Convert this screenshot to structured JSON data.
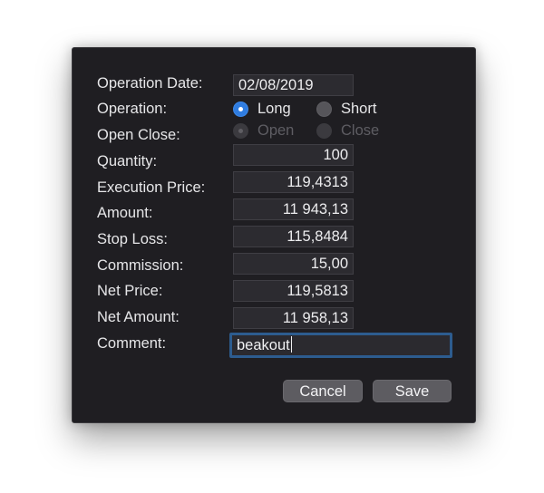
{
  "form": {
    "operation_date": {
      "label": "Operation Date:",
      "value": "02/08/2019"
    },
    "operation": {
      "label": "Operation:",
      "options": [
        {
          "label": "Long",
          "selected": true
        },
        {
          "label": "Short",
          "selected": false
        }
      ]
    },
    "open_close": {
      "label": "Open Close:",
      "disabled": true,
      "options": [
        {
          "label": "Open",
          "selected": true
        },
        {
          "label": "Close",
          "selected": false
        }
      ]
    },
    "quantity": {
      "label": "Quantity:",
      "value": "100"
    },
    "execution_price": {
      "label": "Execution Price:",
      "value": "119,4313"
    },
    "amount": {
      "label": "Amount:",
      "value": "11 943,13"
    },
    "stop_loss": {
      "label": "Stop Loss:",
      "value": "115,8484"
    },
    "commission": {
      "label": "Commission:",
      "value": "15,00"
    },
    "net_price": {
      "label": "Net Price:",
      "value": "119,5813"
    },
    "net_amount": {
      "label": "Net Amount:",
      "value": "11 958,13"
    },
    "comment": {
      "label": "Comment:",
      "value": "beakout"
    }
  },
  "buttons": {
    "cancel_label": "Cancel",
    "save_label": "Save"
  },
  "colors": {
    "dialog_background": "#1f1e22",
    "field_background": "#2c2b30",
    "focus_ring": "#2d5c8f",
    "radio_selected": "#2f7ce0",
    "button_background": "#5d5c61"
  }
}
